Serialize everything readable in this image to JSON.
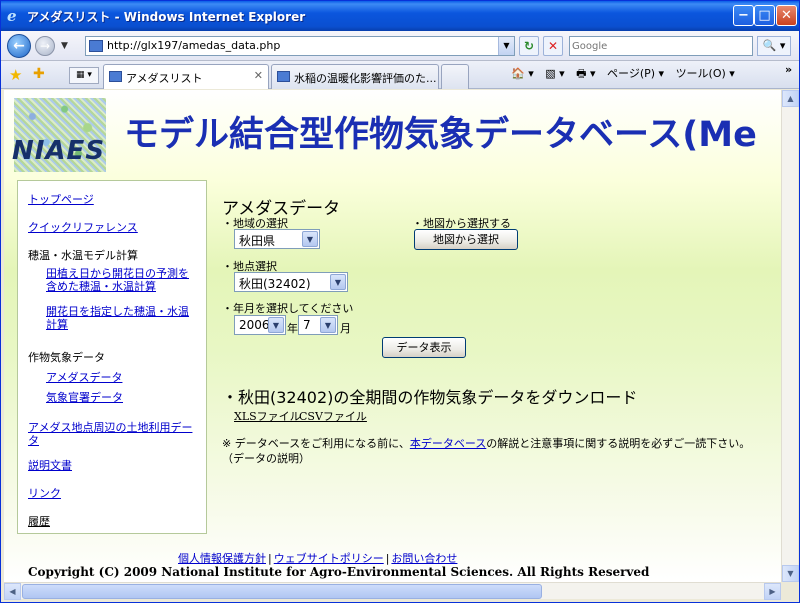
{
  "window": {
    "title": "アメダスリスト - Windows Internet Explorer",
    "min_glyph": "−",
    "max_glyph": "□",
    "close_glyph": "✕"
  },
  "address_bar": {
    "url": "http://glx197/amedas_data.php",
    "search_placeholder": "Google",
    "back_glyph": "←",
    "forward_glyph": "→",
    "refresh_glyph": "↻",
    "stop_glyph": "✕",
    "search_glyph": "🔍 ▾"
  },
  "tabs": [
    {
      "label": "アメダスリスト",
      "close": "✕"
    },
    {
      "label": "水稲の温暖化影響評価のた..."
    }
  ],
  "command_bar": {
    "home": "🏠 ▾",
    "feeds": "▧ ▾",
    "print": "🖶 ▾",
    "page": "ページ(P) ▾",
    "tools": "ツール(O) ▾",
    "more": "»"
  },
  "site": {
    "logo_text": "NIAES",
    "banner_title": "モデル結合型作物気象データベース(Me"
  },
  "sidebar": {
    "top_page": "トップページ",
    "quick_reference": "クイックリファレンス",
    "section_temp_model": "穂温・水温モデル計算",
    "calc_with_prediction": "田植え日から開花日の予測を含めた穂温・水温計算",
    "calc_with_flowering": "開花日を指定した穂温・水温計算",
    "section_crop_weather": "作物気象データ",
    "amedas_data": "アメダスデータ",
    "jma_data": "気象官署データ",
    "land_use": "アメダス地点周辺の土地利用データ",
    "documentation": "説明文書",
    "links": "リンク",
    "history": "履歴"
  },
  "main": {
    "heading": "アメダスデータ",
    "region_label": "・地域の選択",
    "region_value": "秋田県",
    "map_label": "・地図から選択する",
    "map_button": "地図から選択",
    "station_label": "・地点選択",
    "station_value": "秋田(32402)",
    "yearmonth_label": "・年月を選択してください",
    "year_value": "2006",
    "year_unit": "年",
    "month_value": "7",
    "month_unit": "月",
    "display_button": "データ表示",
    "download_heading": "・秋田(32402)の全期間の作物気象データをダウンロード",
    "xls_link": "XLSファイル",
    "csv_link": "CSVファイル",
    "notice_prefix": "※ データベースをご利用になる前に、",
    "notice_link": "本データベース",
    "notice_suffix": "の解説と注意事項に関する説明を必ずご一読下さい。",
    "notice_line2": "（データの説明）",
    "dropdown_glyph": "▼"
  },
  "footer": {
    "privacy": "個人情報保護方針",
    "policy": "ウェブサイトポリシー",
    "contact": "お問い合わせ",
    "separator": "|",
    "copyright": "Copyright (C) 2009 National Institute for Agro-Environmental Sciences. All Rights Reserved"
  },
  "scrollbars": {
    "up": "▲",
    "down": "▼",
    "left": "◀",
    "right": "▶"
  },
  "colors": {
    "title_bar": "#0a4fd0",
    "banner_title": "#1a2fb3",
    "link": "#0000cc"
  }
}
